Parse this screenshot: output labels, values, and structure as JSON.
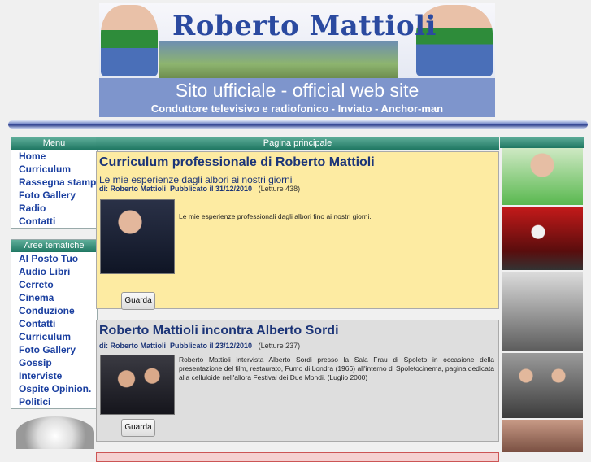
{
  "header": {
    "title": "Roberto Mattioli",
    "subtitle": "Sito ufficiale - official web site",
    "tagline": "Conduttore televisivo e radiofonico - Inviato - Anchor-man"
  },
  "menu": {
    "title": "Menu",
    "items": [
      "Home",
      "Curriculum",
      "Rassegna stampa",
      "Foto Gallery",
      "Radio",
      "Contatti"
    ]
  },
  "areas": {
    "title": "Aree tematiche",
    "items": [
      "Al Posto Tuo",
      "Audio Libri",
      "Cerreto",
      "Cinema",
      "Conduzione",
      "Contatti",
      "Curriculum",
      "Foto Gallery",
      "Gossip",
      "Interviste",
      "Ospite Opinion.",
      "Politici"
    ]
  },
  "main": {
    "title": "Pagina principale",
    "articles": [
      {
        "title": "Curriculum professionale di Roberto Mattioli",
        "subtitle": "Le mie esperienze dagli albori ai nostri giorni",
        "author": "di: Roberto Mattioli",
        "published": "Pubblicato il 31/12/2010",
        "reads": "(Letture 438)",
        "text": "Le mie esperienze professionali dagli albori fino ai nostri giorni.",
        "button": "Guarda"
      },
      {
        "title": "Roberto Mattioli incontra Alberto Sordi",
        "author": "di: Roberto Mattioli",
        "published": "Pubblicato il 23/12/2010",
        "reads": "(Letture 237)",
        "text": "Roberto Mattioli intervista Alberto Sordi presso la Sala Frau di Spoleto in occasione della presentazione del film, restaurato, Fumo di Londra (1966) all'interno di Spoletocinema, pagina dedicata alla celluloide nell'allora Festival dei Due Mondi. (Luglio 2000)",
        "button": "Guarda"
      }
    ]
  },
  "colors": {
    "link": "#1a3fa0",
    "box_header": "#1f7762",
    "article1_bg": "#fdeba2",
    "article2_bg": "#dedede"
  }
}
